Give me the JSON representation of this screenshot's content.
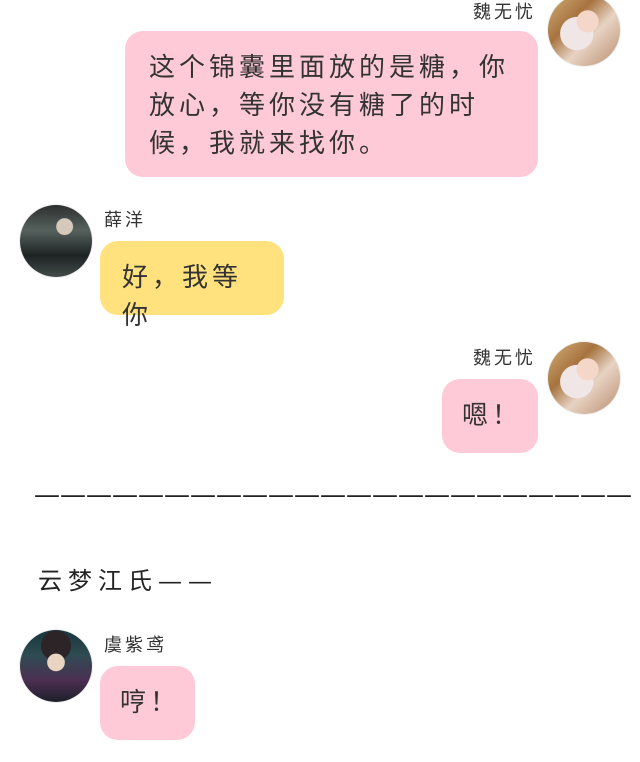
{
  "chat": {
    "messages": [
      {
        "sender": "魏无忧",
        "text": "这个锦囊里面放的是糖，你放心，等你没有糖了的时候，我就来找你。",
        "bubble_color": "#ffcad7"
      },
      {
        "sender": "薛洋",
        "text": "好，我等你",
        "bubble_color": "#ffe27d"
      },
      {
        "sender": "魏无忧",
        "text": "嗯！",
        "bubble_color": "#ffcad7"
      },
      {
        "sender": "虞紫鸢",
        "text": "哼！",
        "bubble_color": "#ffcad7"
      }
    ],
    "divider": "———————————————————————",
    "section_title": "云梦江氏——"
  },
  "icons": {
    "avatar_wei": "avatar-wei-wuyou",
    "avatar_xue": "avatar-xue-yang",
    "avatar_yu": "avatar-yu-ziyuan"
  }
}
